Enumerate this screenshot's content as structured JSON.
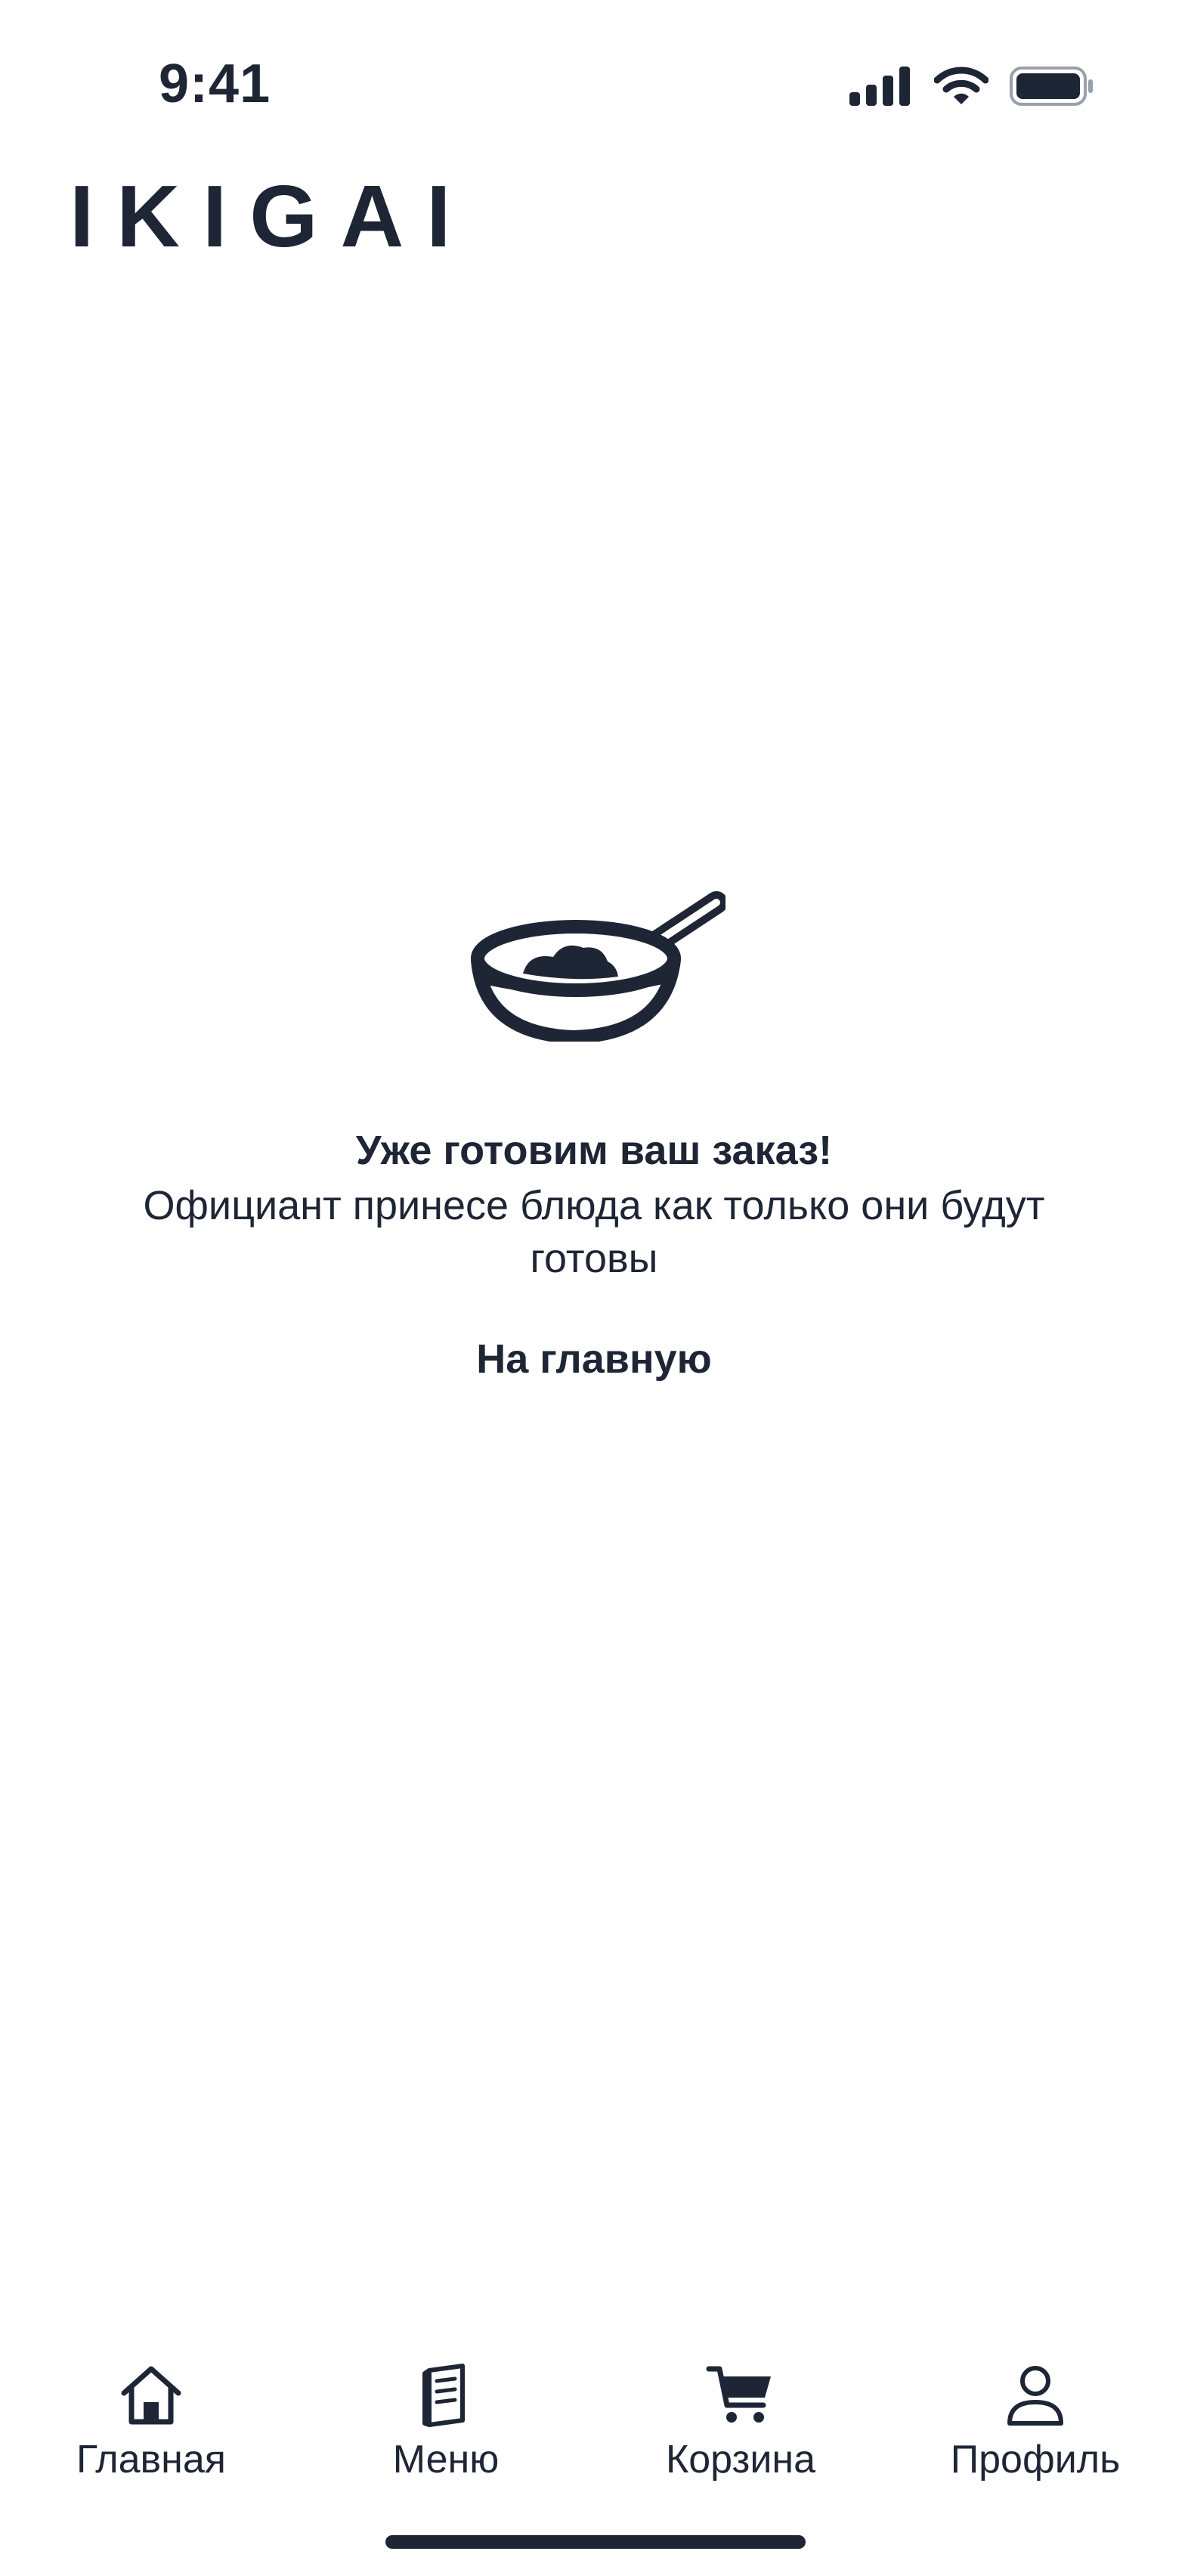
{
  "status_bar": {
    "time": "9:41",
    "icons": [
      "cellular-signal-icon",
      "wifi-icon",
      "battery-icon"
    ]
  },
  "header": {
    "logo": "IKIGAI"
  },
  "confirmation": {
    "icon": "cooking-pan-icon",
    "title": "Уже готовим ваш заказ!",
    "subtitle": "Официант принесе блюда как только они будут готовы",
    "home_link": "На главную"
  },
  "tab_bar": {
    "items": [
      {
        "label": "Главная",
        "icon": "home-icon"
      },
      {
        "label": "Меню",
        "icon": "menu-book-icon"
      },
      {
        "label": "Корзина",
        "icon": "cart-icon"
      },
      {
        "label": "Профиль",
        "icon": "profile-icon"
      }
    ]
  },
  "colors": {
    "primary": "#1e2535",
    "background": "#ffffff"
  }
}
